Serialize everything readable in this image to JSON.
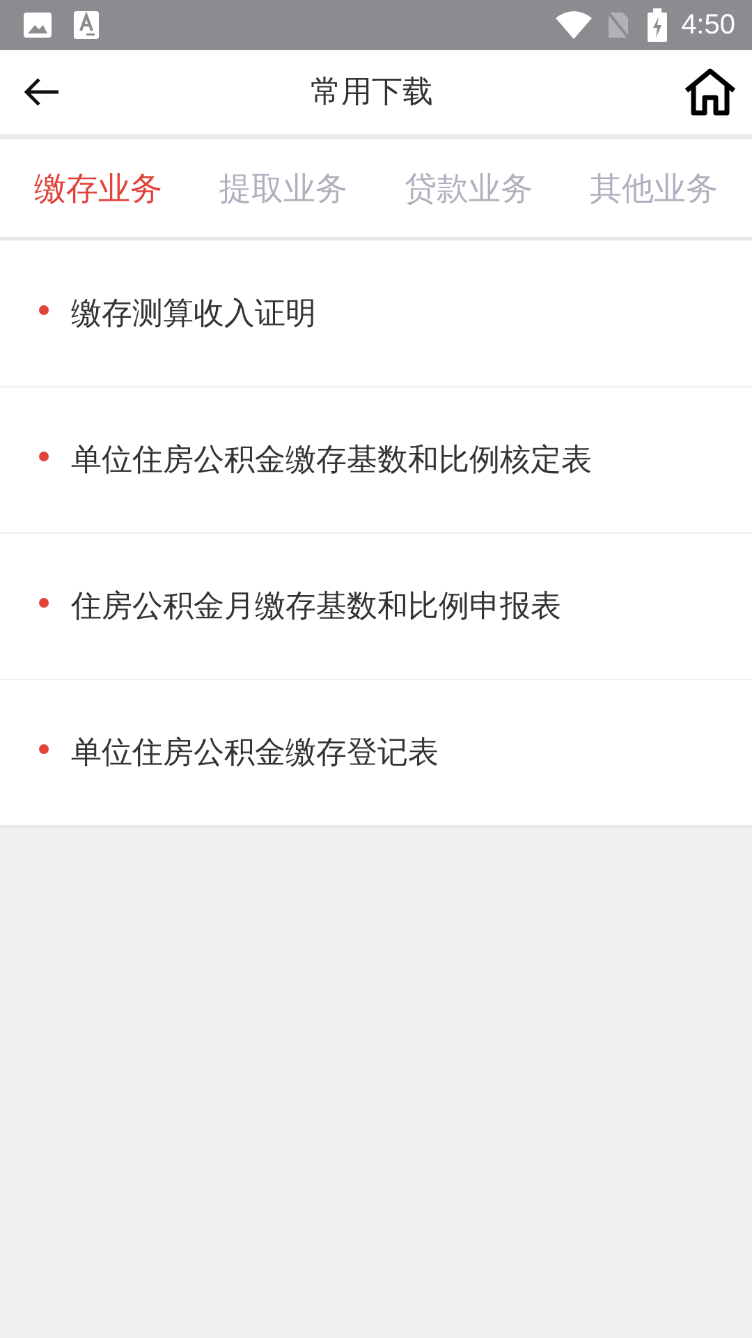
{
  "status_bar": {
    "time": "4:50"
  },
  "header": {
    "title": "常用下载"
  },
  "tabs": [
    {
      "label": "缴存业务",
      "selected": true
    },
    {
      "label": "提取业务",
      "selected": false
    },
    {
      "label": "贷款业务",
      "selected": false
    },
    {
      "label": "其他业务",
      "selected": false
    }
  ],
  "downloads": [
    {
      "title": "缴存测算收入证明"
    },
    {
      "title": "单位住房公积金缴存基数和比例核定表"
    },
    {
      "title": "住房公积金月缴存基数和比例申报表"
    },
    {
      "title": "单位住房公积金缴存登记表"
    }
  ]
}
